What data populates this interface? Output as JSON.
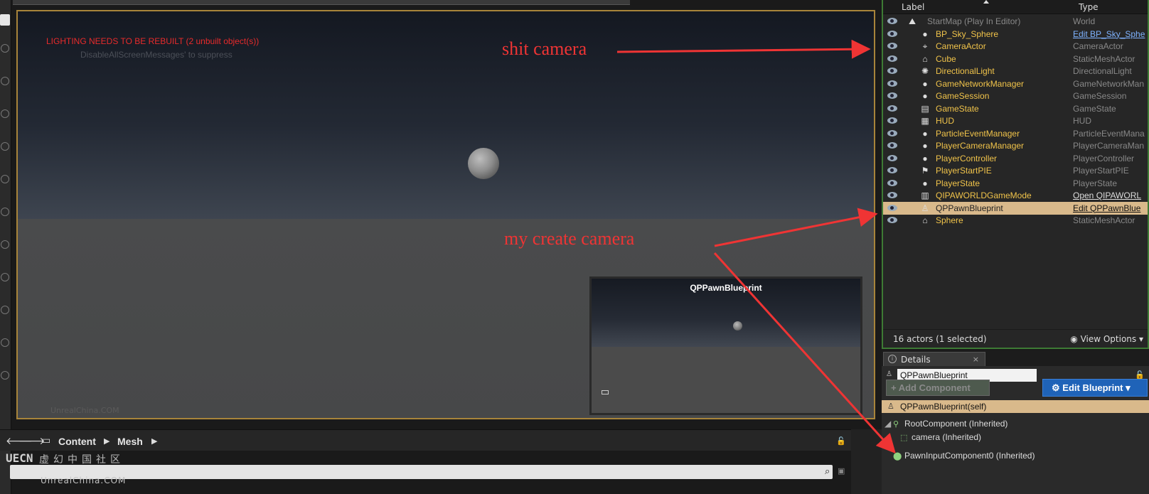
{
  "viewport": {
    "warning": "LIGHTING NEEDS TO BE REBUILT (2 unbuilt object(s))",
    "faint_message": "DisableAllScreenMessages' to suppress",
    "watermark_small": "UnrealChina.COM",
    "pip_title": "QPPawnBlueprint"
  },
  "annotations": {
    "shit_camera": "shit camera",
    "my_create_camera": "my create camera",
    "color": "#ef3434"
  },
  "outliner": {
    "header_label": "Label",
    "header_type": "Type",
    "rows": [
      {
        "label": "StartMap (Play In Editor)",
        "type": "World",
        "icon": "world-icon"
      },
      {
        "label": "BP_Sky_Sphere",
        "type": "Edit BP_Sky_Sphe",
        "icon": "sphere-icon"
      },
      {
        "label": "CameraActor",
        "type": "CameraActor",
        "icon": "camera-actor-icon"
      },
      {
        "label": "Cube",
        "type": "StaticMeshActor",
        "icon": "static-mesh-icon"
      },
      {
        "label": "DirectionalLight",
        "type": "DirectionalLight",
        "icon": "light-icon"
      },
      {
        "label": "GameNetworkManager",
        "type": "GameNetworkMan",
        "icon": "actor-icon"
      },
      {
        "label": "GameSession",
        "type": "GameSession",
        "icon": "actor-icon"
      },
      {
        "label": "GameState",
        "type": "GameState",
        "icon": "game-state-icon"
      },
      {
        "label": "HUD",
        "type": "HUD",
        "icon": "hud-icon"
      },
      {
        "label": "ParticleEventManager",
        "type": "ParticleEventMana",
        "icon": "sphere-icon"
      },
      {
        "label": "PlayerCameraManager",
        "type": "PlayerCameraMan",
        "icon": "actor-icon"
      },
      {
        "label": "PlayerController",
        "type": "PlayerController",
        "icon": "actor-icon"
      },
      {
        "label": "PlayerStartPIE",
        "type": "PlayerStartPIE",
        "icon": "player-start-icon"
      },
      {
        "label": "PlayerState",
        "type": "PlayerState",
        "icon": "sphere-icon"
      },
      {
        "label": "QIPAWORLDGameMode",
        "type": "Open QIPAWORL",
        "icon": "game-mode-icon"
      },
      {
        "label": "QPPawnBlueprint",
        "type": "Edit QPPawnBlue",
        "icon": "pawn-icon"
      },
      {
        "label": "Sphere",
        "type": "StaticMeshActor",
        "icon": "static-mesh-icon"
      }
    ],
    "actors_count": "16 actors (1 selected)",
    "view_options": "View Options"
  },
  "details": {
    "tab_label": "Details",
    "tab_close": "×",
    "name_value": "QPPawnBlueprint",
    "add_component": "+ Add Component",
    "edit_blueprint": "Edit Blueprint",
    "self_component": "QPPawnBlueprint(self)",
    "root_component": "RootComponent (Inherited)",
    "camera_component": "camera (Inherited)",
    "pawn_input": "PawnInputComponent0 (Inherited)"
  },
  "content_browser": {
    "folder": "Content",
    "subfolder": "Mesh"
  },
  "watermark": {
    "cn": "虚幻中国社区",
    "en": "UnrealChina.COM",
    "logo": "UECN"
  }
}
